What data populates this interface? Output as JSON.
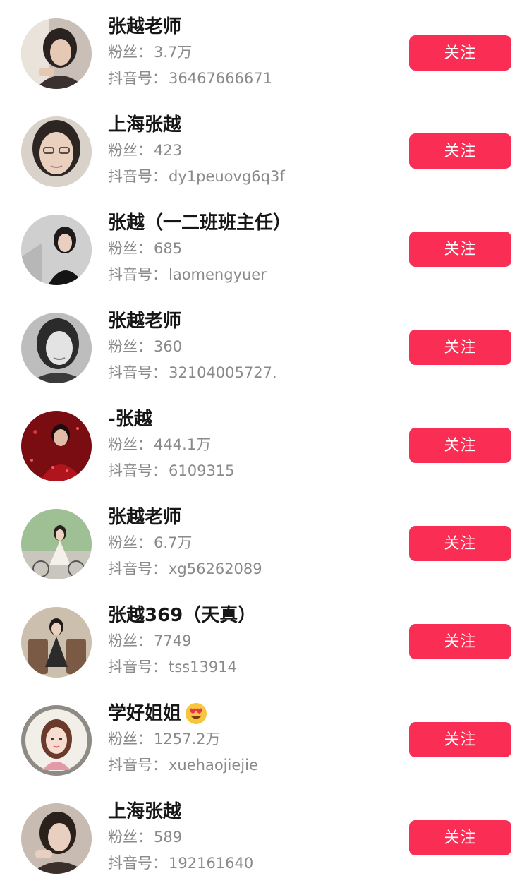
{
  "labels": {
    "fans_prefix": "粉丝：",
    "id_prefix": "抖音号："
  },
  "colors": {
    "follow_button": "#fa2d55",
    "name": "#161616",
    "meta": "#8a8a8a"
  },
  "users": [
    {
      "name": "张越老师",
      "fans": "3.7万",
      "douyin_id": "36467666671",
      "button": "关注",
      "avatar": "woman-portrait-icon"
    },
    {
      "name": "上海张越",
      "fans": "423",
      "douyin_id": "dy1peuovg6q3f",
      "button": "关注",
      "avatar": "woman-selfie-icon"
    },
    {
      "name": "张越（一二班班主任）",
      "fans": "685",
      "douyin_id": "laomengyuer",
      "button": "关注",
      "avatar": "woman-staircase-icon"
    },
    {
      "name": "张越老师",
      "fans": "360",
      "douyin_id": "32104005727.",
      "button": "关注",
      "avatar": "woman-grayscale-icon"
    },
    {
      "name": "-张越",
      "fans": "444.1万",
      "douyin_id": "6109315",
      "button": "关注",
      "avatar": "man-red-backdrop-icon"
    },
    {
      "name": "张越老师",
      "fans": "6.7万",
      "douyin_id": "xg56262089",
      "button": "关注",
      "avatar": "woman-bicycle-icon"
    },
    {
      "name": "张越369（天真）",
      "fans": "7749",
      "douyin_id": "tss13914",
      "button": "关注",
      "avatar": "woman-chair-icon"
    },
    {
      "name": "学好姐姐",
      "fans": "1257.2万",
      "douyin_id": "xuehaojiejie",
      "button": "关注",
      "avatar": "cartoon-girl-icon",
      "emoji": "heart-eyes-emoji-icon"
    },
    {
      "name": "上海张越",
      "fans": "589",
      "douyin_id": "192161640",
      "button": "关注",
      "avatar": "woman-resting-icon"
    }
  ]
}
